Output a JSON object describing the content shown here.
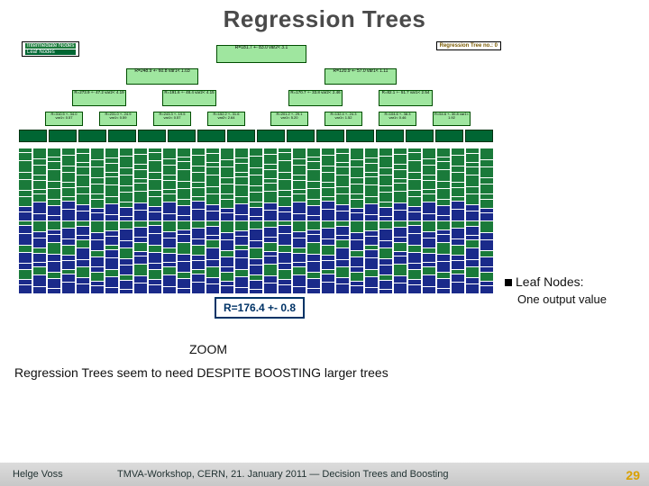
{
  "title": "Regression Trees",
  "legend": {
    "left_line1": "Intermediate Nodes",
    "left_line2": "Leaf Nodes",
    "right": "Regression Tree no.: 0"
  },
  "tree": {
    "root": "R=181.7 +- 83.0\nvar2< 3.1",
    "l1": [
      "R=248.9 +- 60.8\nvar1< 1.03",
      "R=120.9 +- 57.0\nvar1< 1.11"
    ],
    "l2": [
      "R=273.9 +- 47.2\nvar2< 4.19",
      "R=191.6 +- 48.4\nvar2< 4.15",
      "R=170.7 +- 33.8\nvar2< 2.46",
      "R=82.1 +- 51.7\nvar1< 2.54"
    ],
    "l3": [
      "R=310.5 +- 34.0\nvar1< 0.57",
      "R=231.0 +- 24.9\nvar1< 0.59",
      "R=243.3 +- 19.5\nvar1< 0.57",
      "R=152.2 +- 31.6\nvar2< 2.64",
      "R=201.2 +- 29.1\nvar1< 5.20",
      "R=132.4 +- 24.3\nvar1< 1.52",
      "R=104.6 +- 38.3\nvar1< 0.46",
      "R=54.6 +- 30.8\nvar1< 1.92"
    ]
  },
  "zoom_value": "R=176.4 +- 0.8",
  "zoom_label": "ZOOM",
  "bullet": {
    "title": "Leaf Nodes:",
    "sub": "One output value"
  },
  "body_text": "Regression Trees seem to need  DESPITE BOOSTING  larger trees",
  "footer": {
    "author": "Helge Voss",
    "mid": "TMVA-Workshop, CERN,  21. January 2011  ― Decision Trees and Boosting",
    "page": "29"
  }
}
